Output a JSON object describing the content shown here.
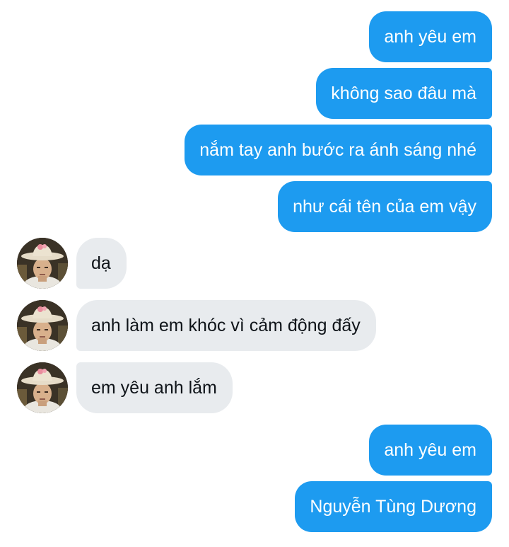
{
  "messages": [
    {
      "direction": "outgoing",
      "text": "anh yêu em"
    },
    {
      "direction": "outgoing",
      "text": "không sao đâu mà"
    },
    {
      "direction": "outgoing",
      "text": "nắm tay anh bước ra ánh sáng nhé"
    },
    {
      "direction": "outgoing",
      "text": "như cái tên của em vậy"
    },
    {
      "direction": "incoming",
      "text": "dạ",
      "avatar": "profile-photo"
    },
    {
      "direction": "incoming",
      "text": "anh làm em khóc vì cảm động đấy",
      "avatar": "profile-photo"
    },
    {
      "direction": "incoming",
      "text": "em yêu anh lắm",
      "avatar": "profile-photo"
    },
    {
      "direction": "outgoing",
      "text": "anh yêu em"
    },
    {
      "direction": "outgoing",
      "text": "Nguyễn Tùng Dương"
    }
  ],
  "colors": {
    "outgoing_bubble": "#1d9bf0",
    "outgoing_text": "#ffffff",
    "incoming_bubble": "#e8ebee",
    "incoming_text": "#0f1419"
  }
}
